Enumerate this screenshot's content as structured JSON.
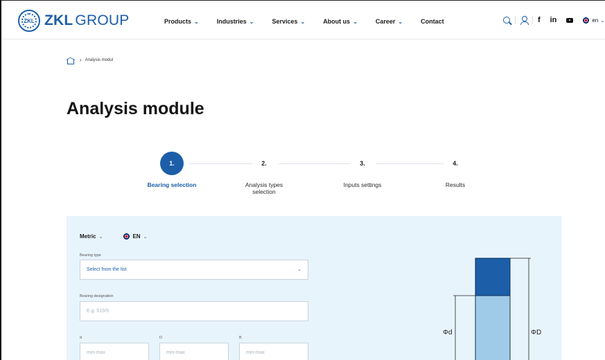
{
  "header": {
    "logo_mark": "ZKL",
    "logo_bold": "ZKL",
    "logo_light": "GROUP",
    "nav": [
      {
        "label": "Products"
      },
      {
        "label": "Industries"
      },
      {
        "label": "Services"
      },
      {
        "label": "About us"
      },
      {
        "label": "Career"
      },
      {
        "label": "Contact"
      }
    ],
    "social": {
      "facebook": "f",
      "linkedin": "in"
    },
    "language": "en"
  },
  "breadcrumb": {
    "current": "Analysis modul"
  },
  "page_title": "Analysis module",
  "stepper": {
    "steps": [
      {
        "number": "1.",
        "label": "Bearing selection",
        "active": true
      },
      {
        "number": "2.",
        "label_line1": "Analysis types",
        "label_line2": "selection",
        "active": false
      },
      {
        "number": "3.",
        "label": "Inputs settings",
        "active": false
      },
      {
        "number": "4.",
        "label": "Results",
        "active": false
      }
    ]
  },
  "form": {
    "unit_system": "Metric",
    "language": "EN",
    "bearing_type": {
      "label": "Bearing type",
      "value": "Select from the list"
    },
    "bearing_designation": {
      "label": "Bearing designation",
      "placeholder": "E.g. 619/9"
    },
    "dims": [
      {
        "label": "d",
        "placeholder": "min-max"
      },
      {
        "label": "D",
        "placeholder": "min-max"
      },
      {
        "label": "B",
        "placeholder": "min-max"
      }
    ]
  },
  "diagram": {
    "inner_label": "Φd",
    "outer_label": "ΦD",
    "colors": {
      "outer_ring": "#1c5ea8",
      "inner_ring": "#9fcbe8"
    }
  },
  "colors": {
    "brand": "#1c5ea8",
    "panel_bg": "#e8f4fb"
  }
}
